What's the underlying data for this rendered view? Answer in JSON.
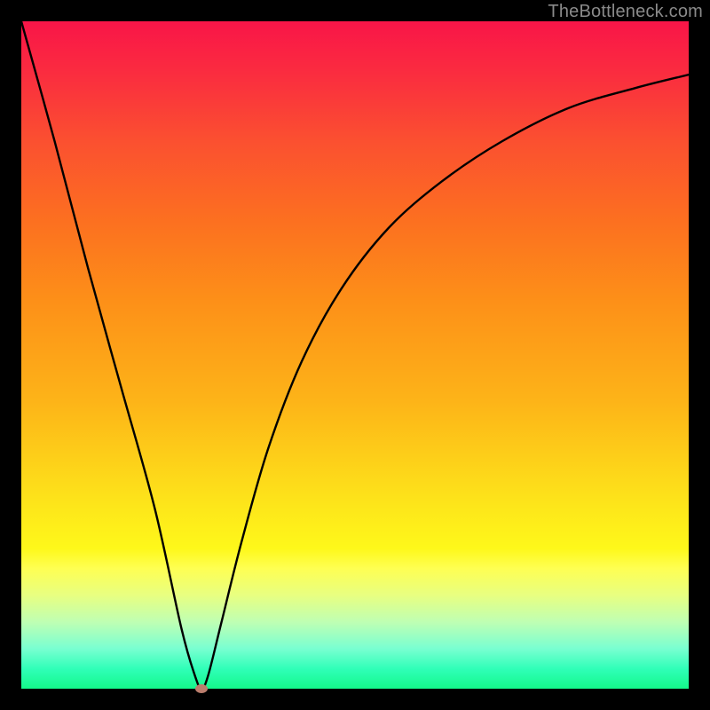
{
  "watermark": "TheBottleneck.com",
  "chart_data": {
    "type": "line",
    "title": "",
    "xlabel": "",
    "ylabel": "",
    "xlim": [
      0,
      100
    ],
    "ylim": [
      0,
      100
    ],
    "grid": false,
    "legend": false,
    "background_gradient": {
      "top_color": "#f91548",
      "bottom_color": "#14f88a",
      "description": "vertical red-to-green gradient"
    },
    "series": [
      {
        "name": "bottleneck-curve",
        "color": "#000000",
        "x": [
          0,
          5,
          10,
          15,
          20,
          24,
          26,
          27,
          28,
          30,
          33,
          37,
          42,
          48,
          55,
          63,
          72,
          82,
          92,
          100
        ],
        "values": [
          100,
          82,
          63,
          45,
          27,
          9,
          2,
          0,
          2,
          10,
          22,
          36,
          49,
          60,
          69,
          76,
          82,
          87,
          90,
          92
        ]
      }
    ],
    "minimum_point": {
      "x": 27,
      "y": 0,
      "marker_color": "#bb7d6d"
    }
  },
  "plot_geometry": {
    "inner_left": 24,
    "inner_top": 24,
    "inner_width": 752,
    "inner_height": 752
  }
}
